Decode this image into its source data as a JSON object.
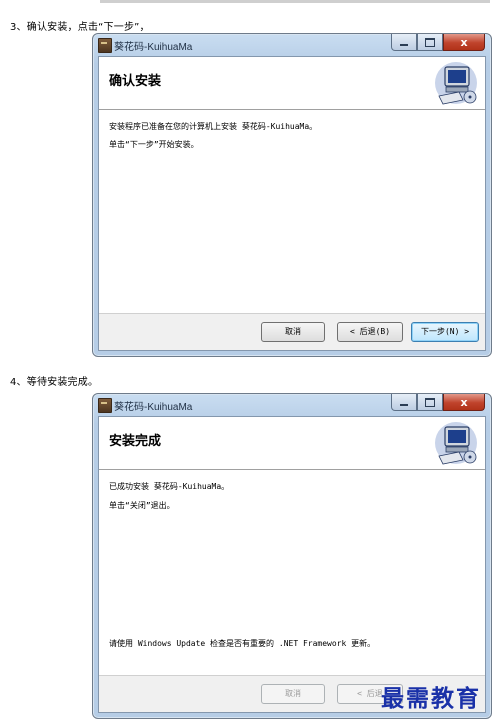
{
  "step3": {
    "caption": "3、确认安装，点击“下一步”，"
  },
  "step4": {
    "caption": "4、等待安装完成。"
  },
  "window1": {
    "title": "葵花码-KuihuaMa",
    "heading": "确认安装",
    "lines": [
      "安装程序已准备在您的计算机上安装 葵花码-KuihuaMa。",
      "单击“下一步”开始安装。"
    ],
    "buttons": {
      "cancel": "取消",
      "back": "< 后退(B)",
      "next": "下一步(N) >"
    }
  },
  "window2": {
    "title": "葵花码-KuihuaMa",
    "heading": "安装完成",
    "lines": [
      "已成功安装 葵花码-KuihuaMa。",
      "单击“关闭”退出。"
    ],
    "note": "请使用 Windows Update 检查是否有重要的 .NET Framework 更新。",
    "buttons": {
      "cancel": "取消",
      "back": "< 后退"
    }
  },
  "controls": {
    "close_glyph": "x"
  },
  "watermark": "最需教育",
  "icons": [
    "computer-setup-icon",
    "installer-app-icon",
    "minimize-icon",
    "maximize-icon",
    "close-icon"
  ]
}
